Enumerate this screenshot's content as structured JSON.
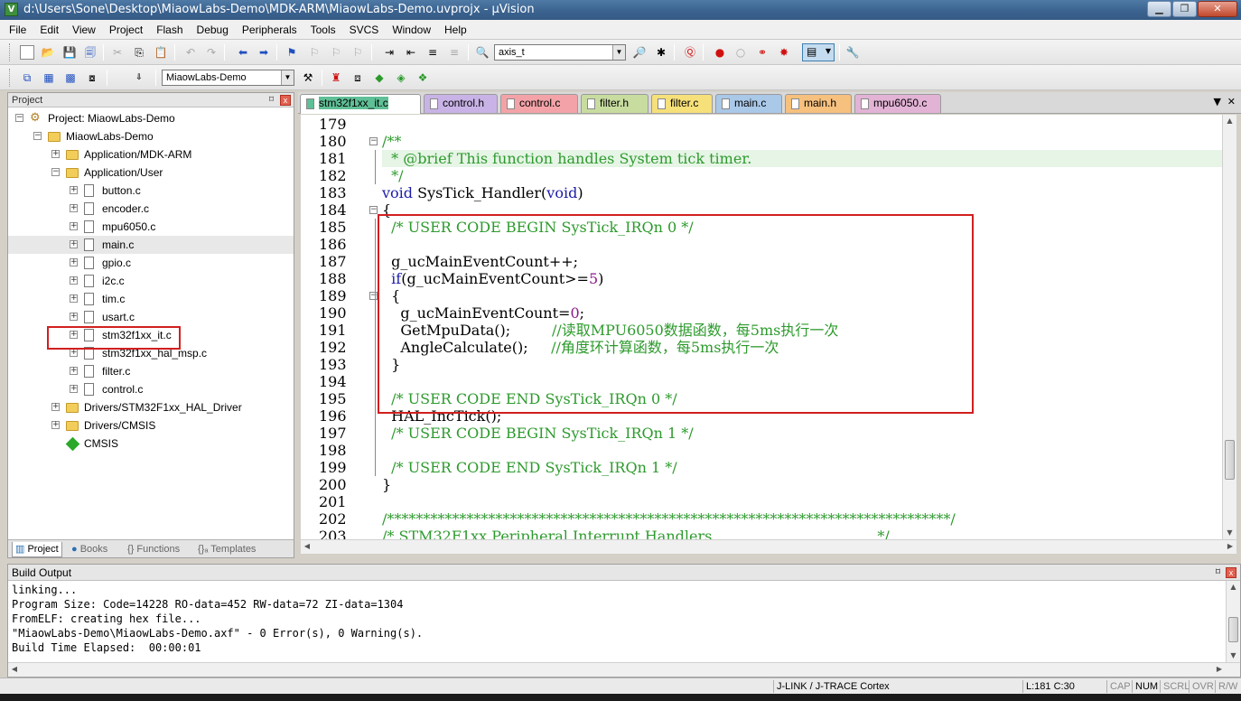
{
  "window": {
    "title": "d:\\Users\\Sone\\Desktop\\MiaowLabs-Demo\\MDK-ARM\\MiaowLabs-Demo.uvprojx - µVision",
    "app_icon_letter": "V"
  },
  "menu": [
    "File",
    "Edit",
    "View",
    "Project",
    "Flash",
    "Debug",
    "Peripherals",
    "Tools",
    "SVCS",
    "Window",
    "Help"
  ],
  "toolbar": {
    "search_value": "axis_t",
    "target_value": "MiaowLabs-Demo"
  },
  "project_panel": {
    "title": "Project",
    "pin_glyph": "⌑",
    "close_glyph": "x",
    "tree": [
      {
        "label": "Project: MiaowLabs-Demo",
        "icon": "project-icon",
        "expanded": true
      },
      {
        "label": "MiaowLabs-Demo",
        "icon": "folder-icon",
        "expanded": true
      },
      {
        "label": "Application/MDK-ARM",
        "icon": "folder-icon",
        "expanded": false
      },
      {
        "label": "Application/User",
        "icon": "folder-icon",
        "expanded": true
      },
      {
        "label": "button.c",
        "icon": "file-icon",
        "expanded": false
      },
      {
        "label": "encoder.c",
        "icon": "file-icon",
        "expanded": false
      },
      {
        "label": "mpu6050.c",
        "icon": "file-icon",
        "expanded": false
      },
      {
        "label": "main.c",
        "icon": "file-icon",
        "expanded": false
      },
      {
        "label": "gpio.c",
        "icon": "file-icon",
        "expanded": false
      },
      {
        "label": "i2c.c",
        "icon": "file-icon",
        "expanded": false
      },
      {
        "label": "tim.c",
        "icon": "file-icon",
        "expanded": false
      },
      {
        "label": "usart.c",
        "icon": "file-icon",
        "expanded": false
      },
      {
        "label": "stm32f1xx_it.c",
        "icon": "file-icon",
        "expanded": false
      },
      {
        "label": "stm32f1xx_hal_msp.c",
        "icon": "file-icon",
        "expanded": false
      },
      {
        "label": "filter.c",
        "icon": "file-icon",
        "expanded": false
      },
      {
        "label": "control.c",
        "icon": "file-icon",
        "expanded": false
      },
      {
        "label": "Drivers/STM32F1xx_HAL_Driver",
        "icon": "folder-icon",
        "expanded": false
      },
      {
        "label": "Drivers/CMSIS",
        "icon": "folder-icon",
        "expanded": false
      },
      {
        "label": "CMSIS",
        "icon": "diamond-icon",
        "expanded": false
      }
    ],
    "tabs": [
      "Project",
      "Books",
      "{} Functions",
      "{}ₐ Templates"
    ]
  },
  "editor": {
    "tabs": [
      {
        "label": "stm32f1xx_it.c",
        "color": "#5fbf96",
        "active": true
      },
      {
        "label": "control.h",
        "color": "#c9b3e6",
        "active": false
      },
      {
        "label": "control.c",
        "color": "#f3a3a8",
        "active": false
      },
      {
        "label": "filter.h",
        "color": "#c8dca0",
        "active": false
      },
      {
        "label": "filter.c",
        "color": "#f6e07a",
        "active": false
      },
      {
        "label": "main.c",
        "color": "#aac8e8",
        "active": false
      },
      {
        "label": "main.h",
        "color": "#f6c07e",
        "active": false
      },
      {
        "label": "mpu6050.c",
        "color": "#e3b3d6",
        "active": false
      }
    ],
    "lines": [
      {
        "n": "179",
        "parts": []
      },
      {
        "n": "180",
        "parts": [
          {
            "t": "/**",
            "c": "cm"
          }
        ]
      },
      {
        "n": "181",
        "parts": [
          {
            "t": "  * @brief This function handles System tick timer.",
            "c": "cm"
          }
        ],
        "hl": true
      },
      {
        "n": "182",
        "parts": [
          {
            "t": "  */",
            "c": "cm"
          }
        ]
      },
      {
        "n": "183",
        "parts": [
          {
            "t": "void",
            "c": "kw"
          },
          {
            "t": " SysTick_Handler(",
            "c": ""
          },
          {
            "t": "void",
            "c": "kw"
          },
          {
            "t": ")",
            "c": ""
          }
        ]
      },
      {
        "n": "184",
        "parts": [
          {
            "t": "{",
            "c": ""
          }
        ]
      },
      {
        "n": "185",
        "parts": [
          {
            "t": "  /* USER CODE BEGIN SysTick_IRQn 0 */",
            "c": "cm"
          }
        ]
      },
      {
        "n": "186",
        "parts": []
      },
      {
        "n": "187",
        "parts": [
          {
            "t": "  g_ucMainEventCount++;",
            "c": ""
          }
        ]
      },
      {
        "n": "188",
        "parts": [
          {
            "t": "  ",
            "c": ""
          },
          {
            "t": "if",
            "c": "kw"
          },
          {
            "t": "(g_ucMainEventCount>=",
            "c": ""
          },
          {
            "t": "5",
            "c": "num"
          },
          {
            "t": ")",
            "c": ""
          }
        ]
      },
      {
        "n": "189",
        "parts": [
          {
            "t": "  {",
            "c": ""
          }
        ]
      },
      {
        "n": "190",
        "parts": [
          {
            "t": "    g_ucMainEventCount=",
            "c": ""
          },
          {
            "t": "0",
            "c": "num"
          },
          {
            "t": ";",
            "c": ""
          }
        ]
      },
      {
        "n": "191",
        "parts": [
          {
            "t": "    GetMpuData();         ",
            "c": ""
          },
          {
            "t": "//读取MPU6050数据函数，每5ms执行一次",
            "c": "cm"
          }
        ]
      },
      {
        "n": "192",
        "parts": [
          {
            "t": "    AngleCalculate();     ",
            "c": ""
          },
          {
            "t": "//角度环计算函数，每5ms执行一次",
            "c": "cm"
          }
        ]
      },
      {
        "n": "193",
        "parts": [
          {
            "t": "  }",
            "c": ""
          }
        ]
      },
      {
        "n": "194",
        "parts": []
      },
      {
        "n": "195",
        "parts": [
          {
            "t": "  /* USER CODE END SysTick_IRQn 0 */",
            "c": "cm"
          }
        ]
      },
      {
        "n": "196",
        "parts": [
          {
            "t": "  HAL_IncTick();",
            "c": ""
          }
        ]
      },
      {
        "n": "197",
        "parts": [
          {
            "t": "  /* USER CODE BEGIN SysTick_IRQn 1 */",
            "c": "cm"
          }
        ]
      },
      {
        "n": "198",
        "parts": []
      },
      {
        "n": "199",
        "parts": [
          {
            "t": "  /* USER CODE END SysTick_IRQn 1 */",
            "c": "cm"
          }
        ]
      },
      {
        "n": "200",
        "parts": [
          {
            "t": "}",
            "c": ""
          }
        ]
      },
      {
        "n": "201",
        "parts": []
      },
      {
        "n": "202",
        "parts": [
          {
            "t": "/******************************************************************************/",
            "c": "cm"
          }
        ]
      },
      {
        "n": "203",
        "parts": [
          {
            "t": "/* STM32F1xx Peripheral Interrupt Handlers                                    */",
            "c": "cm"
          }
        ]
      }
    ]
  },
  "build_output": {
    "title": "Build Output",
    "lines": [
      "linking...",
      "Program Size: Code=14228 RO-data=452 RW-data=72 ZI-data=1304",
      "FromELF: creating hex file...",
      "\"MiaowLabs-Demo\\MiaowLabs-Demo.axf\" - 0 Error(s), 0 Warning(s).",
      "Build Time Elapsed:  00:00:01"
    ]
  },
  "status": {
    "debugger": "J-LINK / J-TRACE Cortex",
    "position": "L:181 C:30",
    "caps": "CAP",
    "num": "NUM",
    "scrl": "SCRL",
    "ovr": "OVR",
    "rw": "R/W"
  },
  "colors": {
    "comment": "#2d9a2d",
    "keyword": "#1c1ca8",
    "annotation_box": "#d21f1f",
    "current_line": "#e6f5e6"
  }
}
